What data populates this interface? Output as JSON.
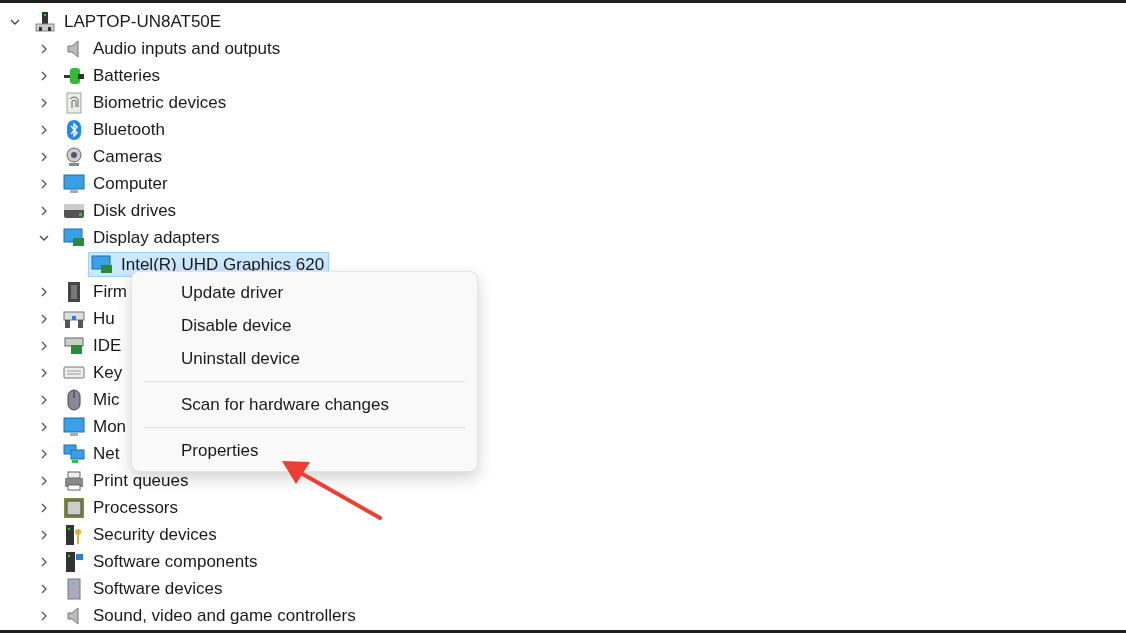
{
  "device_tree": {
    "label": "LAPTOP-UN8AT50E",
    "expanded": true,
    "selected": false,
    "children": [
      {
        "label": "Audio inputs and outputs",
        "expanded": false,
        "selected": false
      },
      {
        "label": "Batteries",
        "expanded": false,
        "selected": false
      },
      {
        "label": "Biometric devices",
        "expanded": false,
        "selected": false
      },
      {
        "label": "Bluetooth",
        "expanded": false,
        "selected": false
      },
      {
        "label": "Cameras",
        "expanded": false,
        "selected": false
      },
      {
        "label": "Computer",
        "expanded": false,
        "selected": false
      },
      {
        "label": "Disk drives",
        "expanded": false,
        "selected": false
      },
      {
        "label": "Display adapters",
        "expanded": true,
        "selected": false,
        "children": [
          {
            "label": "Intel(R) UHD Graphics 620",
            "selected": true
          }
        ]
      },
      {
        "label": "Firm",
        "expanded": false,
        "selected": false
      },
      {
        "label": "Hu",
        "expanded": false,
        "selected": false
      },
      {
        "label": "IDE",
        "expanded": false,
        "selected": false
      },
      {
        "label": "Key",
        "expanded": false,
        "selected": false
      },
      {
        "label": "Mic",
        "expanded": false,
        "selected": false
      },
      {
        "label": "Mon",
        "expanded": false,
        "selected": false
      },
      {
        "label": "Net",
        "expanded": false,
        "selected": false
      },
      {
        "label": "Print queues",
        "expanded": false,
        "selected": false
      },
      {
        "label": "Processors",
        "expanded": false,
        "selected": false
      },
      {
        "label": "Security devices",
        "expanded": false,
        "selected": false
      },
      {
        "label": "Software components",
        "expanded": false,
        "selected": false
      },
      {
        "label": "Software devices",
        "expanded": false,
        "selected": false
      },
      {
        "label": "Sound, video and game controllers",
        "expanded": false,
        "selected": false
      }
    ]
  },
  "context_menu": {
    "items": [
      {
        "kind": "item",
        "label": "Update driver"
      },
      {
        "kind": "item",
        "label": "Disable device"
      },
      {
        "kind": "item",
        "label": "Uninstall device"
      },
      {
        "kind": "separator"
      },
      {
        "kind": "item",
        "label": "Scan for hardware changes"
      },
      {
        "kind": "separator"
      },
      {
        "kind": "item",
        "label": "Properties"
      }
    ]
  },
  "annotations": [
    {
      "kind": "arrow"
    }
  ]
}
